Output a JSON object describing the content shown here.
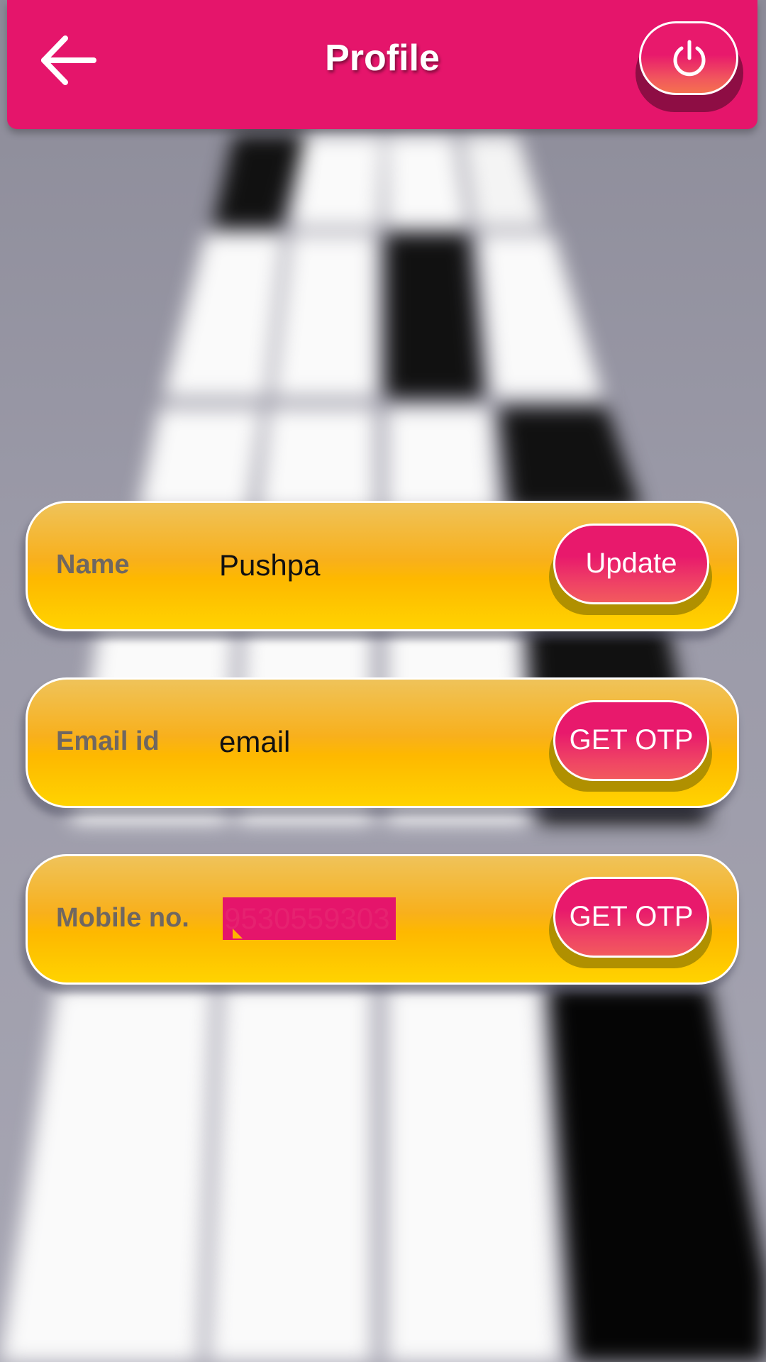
{
  "header": {
    "title": "Profile",
    "back_icon": "arrow-left-icon",
    "power_icon": "power-icon"
  },
  "colors": {
    "header_bg": "#e5156b",
    "card_gradient_top": "#efc35a",
    "card_gradient_bottom": "#ffd300",
    "button_pink": "#e8196c",
    "label_gray": "#6f6761"
  },
  "fields": [
    {
      "label": "Name",
      "value": "Pushpa",
      "action_label": "Update",
      "masked": false
    },
    {
      "label": "Email id",
      "value": "email",
      "action_label": "GET OTP",
      "masked": false
    },
    {
      "label": "Mobile no.",
      "value": "9530559303",
      "action_label": "GET OTP",
      "masked": true
    }
  ]
}
